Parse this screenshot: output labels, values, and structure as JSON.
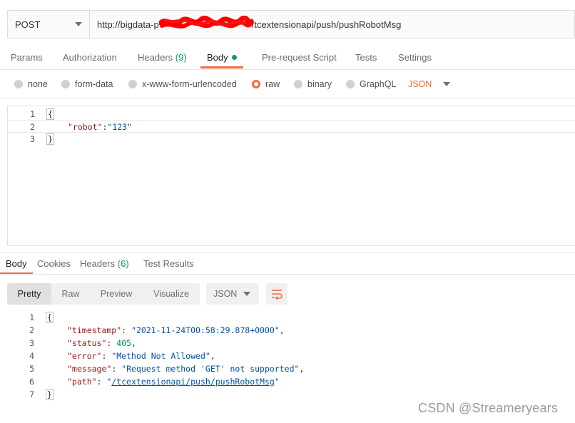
{
  "request": {
    "method": "POST",
    "url_prefix": "http://bigdata-p",
    "url_suffix": "/tcextensionapi/push/pushRobotMsg"
  },
  "request_tabs": [
    {
      "label": "Params",
      "count": ""
    },
    {
      "label": "Authorization",
      "count": ""
    },
    {
      "label": "Headers",
      "count": "(9)"
    },
    {
      "label": "Body",
      "count": ""
    },
    {
      "label": "Pre-request Script",
      "count": ""
    },
    {
      "label": "Tests",
      "count": ""
    },
    {
      "label": "Settings",
      "count": ""
    }
  ],
  "body_types": {
    "options": [
      "none",
      "form-data",
      "x-www-form-urlencoded",
      "raw",
      "binary",
      "GraphQL"
    ],
    "selected": "raw",
    "format": "JSON"
  },
  "request_body": {
    "line_numbers": [
      "1",
      "2",
      "3"
    ],
    "open_brace": "{",
    "key": "\"robot\"",
    "colon": ":",
    "value": "\"123\"",
    "close_brace": "}"
  },
  "response_tabs": [
    {
      "label": "Body",
      "count": ""
    },
    {
      "label": "Cookies",
      "count": ""
    },
    {
      "label": "Headers",
      "count": "(6)"
    },
    {
      "label": "Test Results",
      "count": ""
    }
  ],
  "response_views": [
    "Pretty",
    "Raw",
    "Preview",
    "Visualize"
  ],
  "response_format": "JSON",
  "response_body": {
    "line_numbers": [
      "1",
      "2",
      "3",
      "4",
      "5",
      "6",
      "7"
    ],
    "open_brace": "{",
    "close_brace": "}",
    "fields": [
      {
        "key": "\"timestamp\"",
        "value": "\"2021-11-24T00:58:29.878+0000\"",
        "trail": ","
      },
      {
        "key": "\"status\"",
        "value": "405",
        "trail": ","
      },
      {
        "key": "\"error\"",
        "value": "\"Method Not Allowed\"",
        "trail": ","
      },
      {
        "key": "\"message\"",
        "value": "\"Request method 'GET' not supported\"",
        "trail": ","
      },
      {
        "key": "\"path\"",
        "value_quote": "\"",
        "value_link": "/tcextensionapi/push/pushRobotMsg",
        "trail": ""
      }
    ]
  },
  "watermark": "CSDN @Streameryears",
  "colors": {
    "accent": "#f26b3a",
    "status_green": "#0f9d58",
    "json_key": "#a31515",
    "json_string": "#0451a5",
    "json_number": "#098658",
    "redaction": "#ff0000"
  }
}
